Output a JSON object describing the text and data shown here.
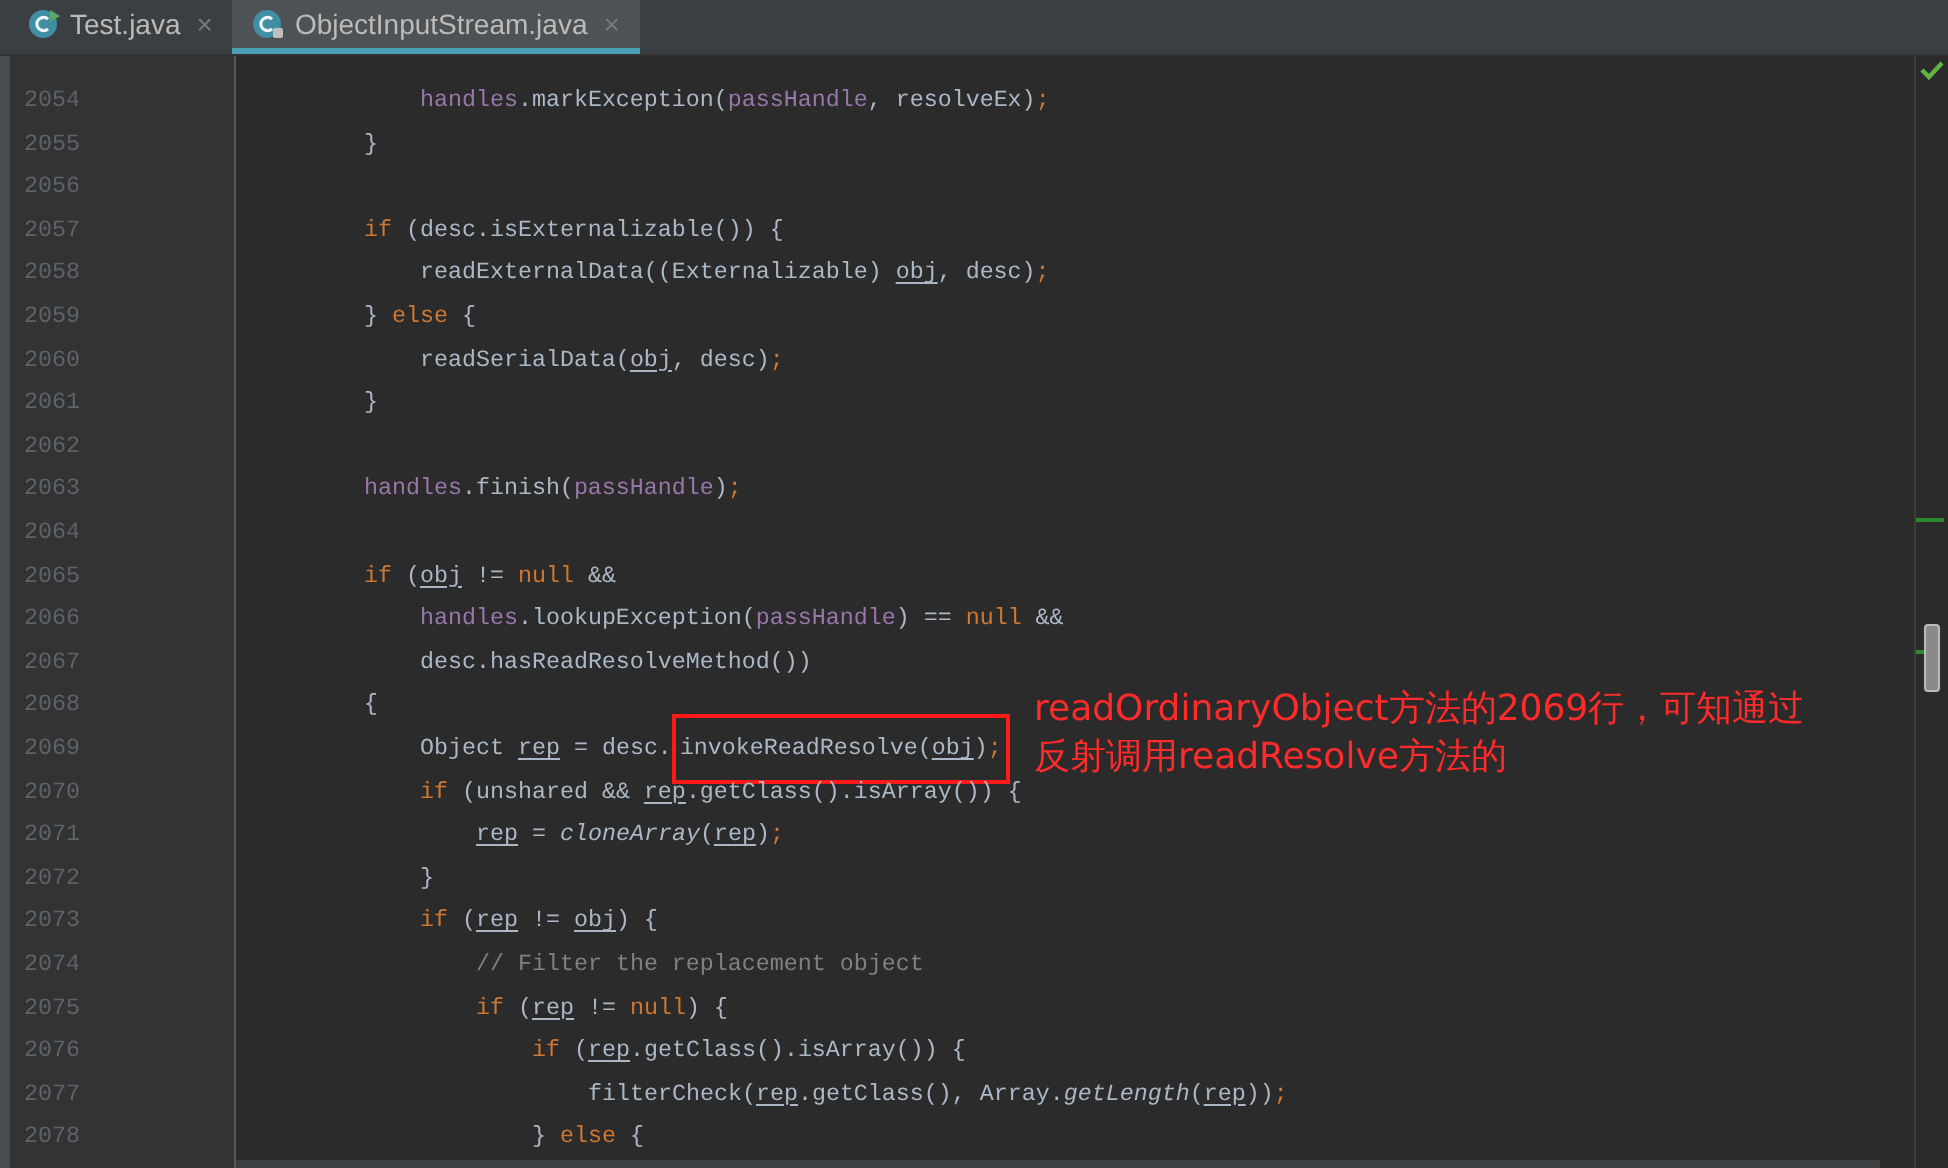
{
  "tabs": [
    {
      "label": "Test.java",
      "selected": false,
      "close": "×"
    },
    {
      "label": "ObjectInputStream.java",
      "selected": true,
      "close": "×"
    }
  ],
  "editor": {
    "lines": [
      {
        "children": [
          {
            "number": "2054",
            "tokens": [
              {
                "text": "handles",
                "kind": "field"
              },
              {
                "text": ".markException(",
                "kind": "plain"
              },
              {
                "text": "passHandle",
                "kind": "field"
              },
              {
                "text": ", resolveEx)",
                "kind": "plain"
              },
              {
                "text": ";",
                "kind": "keyword"
              }
            ]
          }
        ]
      },
      {
        "number": "2055",
        "tokens": [
          {
            "text": "}",
            "kind": "plain"
          }
        ]
      },
      {
        "number": "2056"
      },
      {
        "number": "2057",
        "tokens": [
          {
            "text": "if",
            "kind": "keyword"
          },
          {
            "text": " (desc.isExternalizable()) {",
            "kind": "plain"
          }
        ],
        "children": [
          {
            "number": "2058",
            "tokens": [
              {
                "text": "readExternalData((Externalizable) ",
                "kind": "plain"
              },
              {
                "text": "obj",
                "kind": "variable"
              },
              {
                "text": ", desc)",
                "kind": "plain"
              },
              {
                "text": ";",
                "kind": "keyword"
              }
            ]
          }
        ]
      },
      {
        "number": "2059",
        "tokens": [
          {
            "text": "} ",
            "kind": "plain"
          },
          {
            "text": "else",
            "kind": "keyword"
          },
          {
            "text": " {",
            "kind": "plain"
          }
        ],
        "children": [
          {
            "number": "2060",
            "tokens": [
              {
                "text": "readSerialData(",
                "kind": "plain"
              },
              {
                "text": "obj",
                "kind": "variable"
              },
              {
                "text": ", desc)",
                "kind": "plain"
              },
              {
                "text": ";",
                "kind": "keyword"
              }
            ]
          }
        ]
      },
      {
        "number": "2061",
        "tokens": [
          {
            "text": "}",
            "kind": "plain"
          }
        ]
      },
      {
        "number": "2062"
      },
      {
        "number": "2063",
        "tokens": [
          {
            "text": "handles",
            "kind": "field"
          },
          {
            "text": ".finish(",
            "kind": "plain"
          },
          {
            "text": "passHandle",
            "kind": "field"
          },
          {
            "text": ")",
            "kind": "plain"
          },
          {
            "text": ";",
            "kind": "keyword"
          }
        ]
      },
      {
        "number": "2064"
      },
      {
        "number": "2065",
        "tokens": [
          {
            "text": "if",
            "kind": "keyword"
          },
          {
            "text": " (",
            "kind": "plain"
          },
          {
            "text": "obj",
            "kind": "variable"
          },
          {
            "text": " != ",
            "kind": "plain"
          },
          {
            "text": "null",
            "kind": "keyword"
          },
          {
            "text": " &&",
            "kind": "plain"
          }
        ],
        "children": [
          {
            "number": "2066",
            "tokens": [
              {
                "text": "handles",
                "kind": "field"
              },
              {
                "text": ".lookupException(",
                "kind": "plain"
              },
              {
                "text": "passHandle",
                "kind": "field"
              },
              {
                "text": ") == ",
                "kind": "plain"
              },
              {
                "text": "null",
                "kind": "keyword"
              },
              {
                "text": " &&",
                "kind": "plain"
              }
            ]
          },
          {
            "number": "2067",
            "tokens": [
              {
                "text": "desc.hasReadResolveMethod())",
                "kind": "plain"
              }
            ]
          }
        ]
      },
      {
        "number": "2068",
        "tokens": [
          {
            "text": "{",
            "kind": "plain"
          }
        ],
        "children": [
          {
            "number": "2069",
            "tokens": [
              {
                "text": "Object ",
                "kind": "plain"
              },
              {
                "text": "rep",
                "kind": "variable"
              },
              {
                "text": " = desc.",
                "kind": "plain"
              },
              {
                "text": "invokeReadResolve(",
                "kind": "plain",
                "boxed": true
              },
              {
                "text": "obj",
                "kind": "variable",
                "boxed": true
              },
              {
                "text": ")",
                "kind": "plain",
                "boxed": true
              },
              {
                "text": ";",
                "kind": "keyword",
                "boxed": true
              }
            ]
          },
          {
            "number": "2070",
            "tokens": [
              {
                "text": "if",
                "kind": "keyword"
              },
              {
                "text": " (unshared && ",
                "kind": "plain"
              },
              {
                "text": "rep",
                "kind": "variable"
              },
              {
                "text": ".getClass().isArray()) {",
                "kind": "plain"
              }
            ],
            "children": [
              {
                "number": "2071",
                "tokens": [
                  {
                    "text": "rep",
                    "kind": "variable"
                  },
                  {
                    "text": " = ",
                    "kind": "plain"
                  },
                  {
                    "text": "cloneArray",
                    "kind": "static"
                  },
                  {
                    "text": "(",
                    "kind": "plain"
                  },
                  {
                    "text": "rep",
                    "kind": "variable"
                  },
                  {
                    "text": ")",
                    "kind": "plain"
                  },
                  {
                    "text": ";",
                    "kind": "keyword"
                  }
                ]
              }
            ]
          },
          {
            "number": "2072",
            "tokens": [
              {
                "text": "}",
                "kind": "plain"
              }
            ]
          },
          {
            "number": "2073",
            "tokens": [
              {
                "text": "if",
                "kind": "keyword"
              },
              {
                "text": " (",
                "kind": "plain"
              },
              {
                "text": "rep",
                "kind": "variable"
              },
              {
                "text": " != ",
                "kind": "plain"
              },
              {
                "text": "obj",
                "kind": "variable"
              },
              {
                "text": ") {",
                "kind": "plain"
              }
            ],
            "children": [
              {
                "number": "2074",
                "tokens": [
                  {
                    "text": "// Filter the replacement object",
                    "kind": "comment"
                  }
                ]
              },
              {
                "number": "2075",
                "tokens": [
                  {
                    "text": "if",
                    "kind": "keyword"
                  },
                  {
                    "text": " (",
                    "kind": "plain"
                  },
                  {
                    "text": "rep",
                    "kind": "variable"
                  },
                  {
                    "text": " != ",
                    "kind": "plain"
                  },
                  {
                    "text": "null",
                    "kind": "keyword"
                  },
                  {
                    "text": ") {",
                    "kind": "plain"
                  }
                ],
                "children": [
                  {
                    "number": "2076",
                    "tokens": [
                      {
                        "text": "if",
                        "kind": "keyword"
                      },
                      {
                        "text": " (",
                        "kind": "plain"
                      },
                      {
                        "text": "rep",
                        "kind": "variable"
                      },
                      {
                        "text": ".getClass().isArray()) {",
                        "kind": "plain"
                      }
                    ],
                    "children": [
                      {
                        "number": "2077",
                        "tokens": [
                          {
                            "text": "filterCheck(",
                            "kind": "plain"
                          },
                          {
                            "text": "rep",
                            "kind": "variable"
                          },
                          {
                            "text": ".getClass(), Array.",
                            "kind": "plain"
                          },
                          {
                            "text": "getLength",
                            "kind": "static"
                          },
                          {
                            "text": "(",
                            "kind": "plain"
                          },
                          {
                            "text": "rep",
                            "kind": "variable"
                          },
                          {
                            "text": "))",
                            "kind": "plain"
                          },
                          {
                            "text": ";",
                            "kind": "keyword"
                          }
                        ]
                      }
                    ]
                  },
                  {
                    "number": "2078",
                    "tokens": [
                      {
                        "text": "} ",
                        "kind": "plain"
                      },
                      {
                        "text": "else",
                        "kind": "keyword"
                      },
                      {
                        "text": " {",
                        "kind": "plain"
                      }
                    ]
                  }
                ]
              }
            ]
          }
        ]
      }
    ]
  },
  "annotation": {
    "lines": [
      "readOrdinaryObject方法的2069行，可知通过",
      "反射调用readResolve方法的"
    ]
  }
}
